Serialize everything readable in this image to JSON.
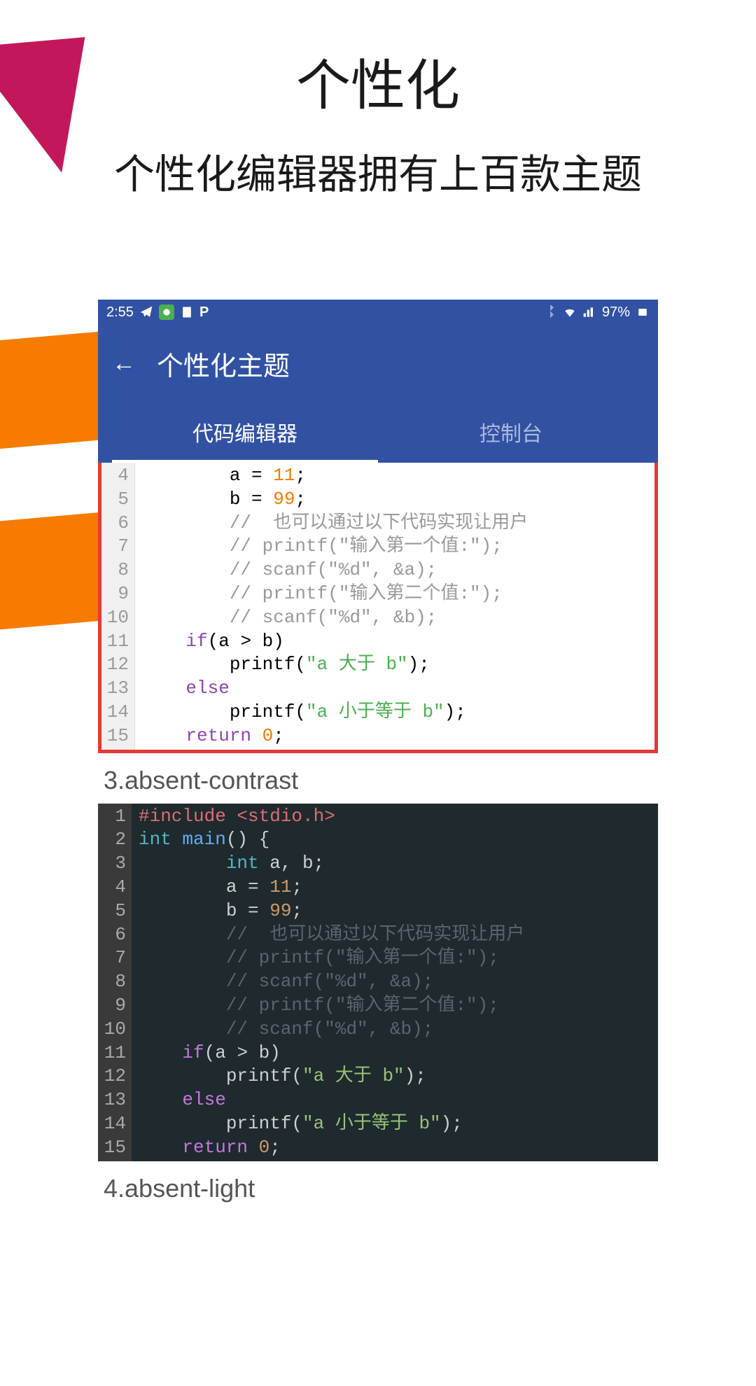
{
  "header": {
    "title": "个性化",
    "subtitle": "个性化编辑器拥有上百款主题"
  },
  "status_bar": {
    "time": "2:55",
    "battery_pct": "97%"
  },
  "app_bar": {
    "title": "个性化主题",
    "tabs": [
      {
        "label": "代码编辑器",
        "active": true
      },
      {
        "label": "控制台",
        "active": false
      }
    ]
  },
  "theme_labels": {
    "theme3": "3.absent-contrast",
    "theme4": "4.absent-light"
  },
  "code_light": {
    "lines": [
      {
        "n": "4",
        "segs": [
          {
            "t": "        a = ",
            "c": ""
          },
          {
            "t": "11",
            "c": "tok-num"
          },
          {
            "t": ";",
            "c": ""
          }
        ]
      },
      {
        "n": "5",
        "segs": [
          {
            "t": "        b = ",
            "c": ""
          },
          {
            "t": "99",
            "c": "tok-num"
          },
          {
            "t": ";",
            "c": ""
          }
        ]
      },
      {
        "n": "6",
        "segs": [
          {
            "t": "        //  也可以通过以下代码实现让用户",
            "c": "tok-comment"
          }
        ]
      },
      {
        "n": "7",
        "segs": [
          {
            "t": "        // printf(\"输入第一个值:\");",
            "c": "tok-comment"
          }
        ]
      },
      {
        "n": "8",
        "segs": [
          {
            "t": "        // scanf(\"%d\", &a);",
            "c": "tok-comment"
          }
        ]
      },
      {
        "n": "9",
        "segs": [
          {
            "t": "        // printf(\"输入第二个值:\");",
            "c": "tok-comment"
          }
        ]
      },
      {
        "n": "10",
        "segs": [
          {
            "t": "        // scanf(\"%d\", &b);",
            "c": "tok-comment"
          }
        ]
      },
      {
        "n": "11",
        "segs": [
          {
            "t": "    ",
            "c": ""
          },
          {
            "t": "if",
            "c": "tok-keyword"
          },
          {
            "t": "(a > b)",
            "c": ""
          }
        ]
      },
      {
        "n": "12",
        "segs": [
          {
            "t": "        printf(",
            "c": ""
          },
          {
            "t": "\"a 大于 b\"",
            "c": "tok-string"
          },
          {
            "t": ");",
            "c": ""
          }
        ]
      },
      {
        "n": "13",
        "segs": [
          {
            "t": "    ",
            "c": ""
          },
          {
            "t": "else",
            "c": "tok-keyword"
          }
        ]
      },
      {
        "n": "14",
        "segs": [
          {
            "t": "        printf(",
            "c": ""
          },
          {
            "t": "\"a 小于等于 b\"",
            "c": "tok-string"
          },
          {
            "t": ");",
            "c": ""
          }
        ]
      },
      {
        "n": "15",
        "segs": [
          {
            "t": "    ",
            "c": ""
          },
          {
            "t": "return",
            "c": "tok-keyword"
          },
          {
            "t": " ",
            "c": ""
          },
          {
            "t": "0",
            "c": "tok-num"
          },
          {
            "t": ";",
            "c": ""
          }
        ]
      }
    ]
  },
  "code_dark": {
    "lines": [
      {
        "n": "1",
        "segs": [
          {
            "t": "#include <stdio.h>",
            "c": "tok-preproc-dark"
          }
        ]
      },
      {
        "n": "2",
        "segs": [
          {
            "t": "int",
            "c": "tok-type-dark"
          },
          {
            "t": " ",
            "c": ""
          },
          {
            "t": "main",
            "c": "tok-func-dark"
          },
          {
            "t": "() {",
            "c": ""
          }
        ]
      },
      {
        "n": "3",
        "segs": [
          {
            "t": "        ",
            "c": ""
          },
          {
            "t": "int",
            "c": "tok-type-dark"
          },
          {
            "t": " a, b;",
            "c": ""
          }
        ]
      },
      {
        "n": "4",
        "segs": [
          {
            "t": "        a = ",
            "c": ""
          },
          {
            "t": "11",
            "c": "tok-num-dark"
          },
          {
            "t": ";",
            "c": ""
          }
        ]
      },
      {
        "n": "5",
        "segs": [
          {
            "t": "        b = ",
            "c": ""
          },
          {
            "t": "99",
            "c": "tok-num-dark"
          },
          {
            "t": ";",
            "c": ""
          }
        ]
      },
      {
        "n": "6",
        "segs": [
          {
            "t": "        //  也可以通过以下代码实现让用户",
            "c": "tok-comment-dark"
          }
        ]
      },
      {
        "n": "7",
        "segs": [
          {
            "t": "        // printf(\"输入第一个值:\");",
            "c": "tok-comment-dark"
          }
        ]
      },
      {
        "n": "8",
        "segs": [
          {
            "t": "        // scanf(\"%d\", &a);",
            "c": "tok-comment-dark"
          }
        ]
      },
      {
        "n": "9",
        "segs": [
          {
            "t": "        // printf(\"输入第二个值:\");",
            "c": "tok-comment-dark"
          }
        ]
      },
      {
        "n": "10",
        "segs": [
          {
            "t": "        // scanf(\"%d\", &b);",
            "c": "tok-comment-dark"
          }
        ]
      },
      {
        "n": "11",
        "segs": [
          {
            "t": "    ",
            "c": ""
          },
          {
            "t": "if",
            "c": "tok-keyword-dark"
          },
          {
            "t": "(a > b)",
            "c": ""
          }
        ]
      },
      {
        "n": "12",
        "segs": [
          {
            "t": "        printf(",
            "c": ""
          },
          {
            "t": "\"a 大于 b\"",
            "c": "tok-string-dark"
          },
          {
            "t": ");",
            "c": ""
          }
        ]
      },
      {
        "n": "13",
        "segs": [
          {
            "t": "    ",
            "c": ""
          },
          {
            "t": "else",
            "c": "tok-keyword-dark"
          }
        ]
      },
      {
        "n": "14",
        "segs": [
          {
            "t": "        printf(",
            "c": ""
          },
          {
            "t": "\"a 小于等于 b\"",
            "c": "tok-string-dark"
          },
          {
            "t": ");",
            "c": ""
          }
        ]
      },
      {
        "n": "15",
        "segs": [
          {
            "t": "    ",
            "c": ""
          },
          {
            "t": "return",
            "c": "tok-keyword-dark"
          },
          {
            "t": " ",
            "c": ""
          },
          {
            "t": "0",
            "c": "tok-num-dark"
          },
          {
            "t": ";",
            "c": ""
          }
        ]
      }
    ]
  }
}
